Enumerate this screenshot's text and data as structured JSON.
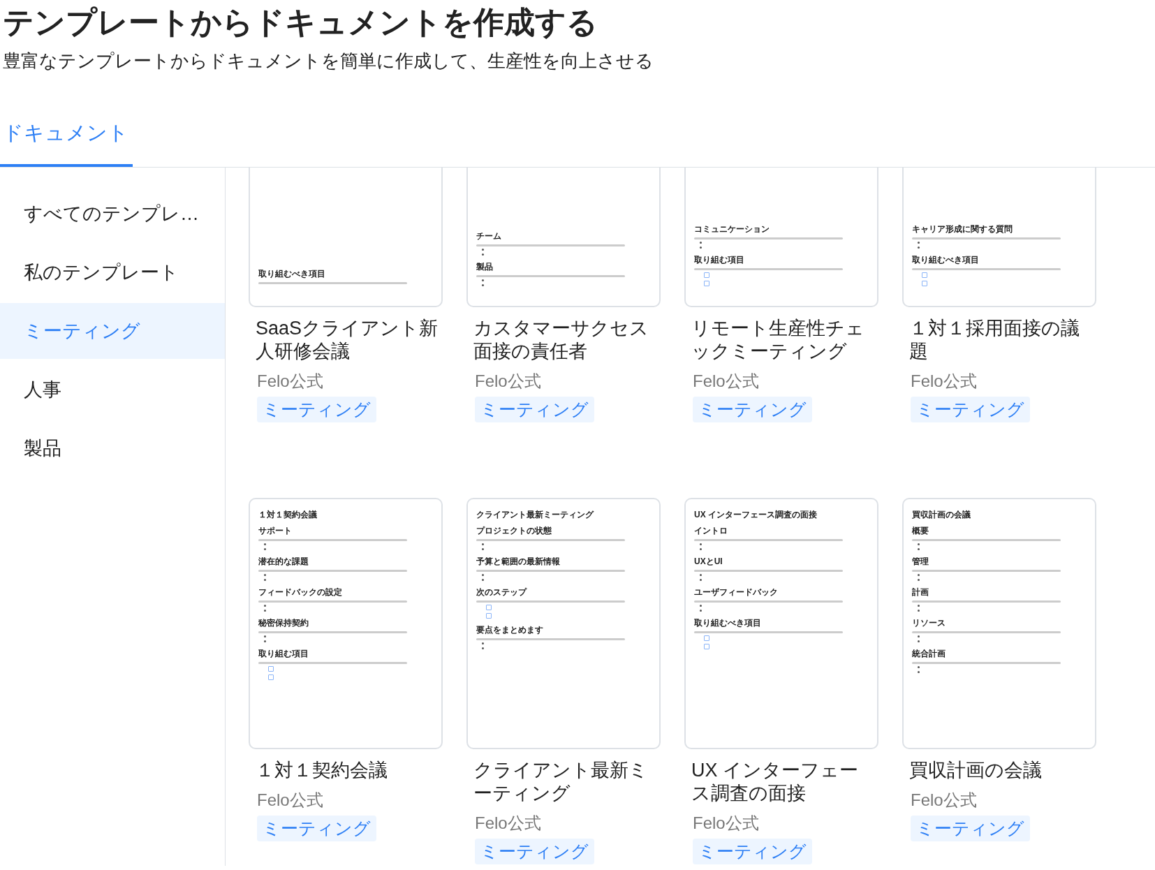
{
  "header": {
    "title": "テンプレートからドキュメントを作成する",
    "subtitle": "豊富なテンプレートからドキュメントを簡単に作成して、生産性を向上させる"
  },
  "tabs": [
    {
      "label": "ドキュメント",
      "selected": true
    }
  ],
  "sidebar": {
    "items": [
      {
        "label": "すべてのテンプレ…",
        "selected": false
      },
      {
        "label": "私のテンプレート",
        "selected": false
      },
      {
        "label": "ミーティング",
        "selected": true
      },
      {
        "label": "人事",
        "selected": false
      },
      {
        "label": "製品",
        "selected": false
      }
    ]
  },
  "templates": [
    {
      "title": "SaaSクライアント新人研修会議",
      "author": "Felo公式",
      "tag": "ミーティング",
      "preview": {
        "sections": [
          {
            "heading": "取り組むべき項目"
          }
        ]
      }
    },
    {
      "title": "カスタマーサクセス面接の責任者",
      "author": "Felo公式",
      "tag": "ミーティング",
      "preview": {
        "sections": [
          {
            "heading": "チーム",
            "kind": "bullets"
          },
          {
            "heading": "製品",
            "kind": "bullets"
          }
        ]
      }
    },
    {
      "title": "リモート生産性チェックミーティング",
      "author": "Felo公式",
      "tag": "ミーティング",
      "preview": {
        "sections": [
          {
            "heading": "コミュニケーション",
            "kind": "bullets"
          },
          {
            "heading": "取り組む項目",
            "kind": "checkboxes",
            "checkboxes": [
              {
                "checked": false
              },
              {
                "checked": false
              }
            ]
          }
        ]
      }
    },
    {
      "title": "１対１採用面接の議題",
      "author": "Felo公式",
      "tag": "ミーティング",
      "preview": {
        "sections": [
          {
            "heading": "キャリア形成に関する質問",
            "kind": "bullets"
          },
          {
            "heading": "取り組むべき項目",
            "kind": "checkboxes",
            "checkboxes": [
              {
                "checked": false
              },
              {
                "checked": false
              }
            ]
          }
        ]
      }
    },
    {
      "title": "１対１契約会議",
      "author": "Felo公式",
      "tag": "ミーティング",
      "preview": {
        "title": "１対１契約会議",
        "sections": [
          {
            "heading": "サポート",
            "kind": "bullets"
          },
          {
            "heading": "潜在的な課題",
            "kind": "bullets"
          },
          {
            "heading": "フィードバックの設定",
            "kind": "bullets"
          },
          {
            "heading": "秘密保持契約",
            "kind": "bullets"
          },
          {
            "heading": "取り組む項目",
            "kind": "checkboxes",
            "checkboxes": [
              {
                "checked": false
              },
              {
                "checked": false
              }
            ]
          }
        ]
      }
    },
    {
      "title": "クライアント最新ミーティング",
      "author": "Felo公式",
      "tag": "ミーティング",
      "preview": {
        "title": "クライアント最新ミーティング",
        "sections": [
          {
            "heading": "プロジェクトの状態",
            "kind": "bullets"
          },
          {
            "heading": "予算と範囲の最新情報",
            "kind": "bullets"
          },
          {
            "heading": "次のステップ",
            "kind": "checkboxes",
            "checkboxes": [
              {
                "checked": false
              },
              {
                "checked": false
              }
            ]
          },
          {
            "heading": "要点をまとめます",
            "kind": "bullets"
          }
        ]
      }
    },
    {
      "title": "UX インターフェース調査の面接",
      "author": "Felo公式",
      "tag": "ミーティング",
      "preview": {
        "title": "UX インターフェース調査の面接",
        "sections": [
          {
            "heading": "イントロ",
            "kind": "bullets"
          },
          {
            "heading": "UXとUI",
            "kind": "bullets"
          },
          {
            "heading": "ユーザフィードバック",
            "kind": "bullets"
          },
          {
            "heading": "取り組むべき項目",
            "kind": "checkboxes",
            "checkboxes": [
              {
                "checked": false
              },
              {
                "checked": false
              }
            ]
          }
        ]
      }
    },
    {
      "title": "買収計画の会議",
      "author": "Felo公式",
      "tag": "ミーティング",
      "preview": {
        "title": "買収計画の会議",
        "sections": [
          {
            "heading": "概要",
            "kind": "bullets"
          },
          {
            "heading": "管理",
            "kind": "bullets"
          },
          {
            "heading": "計画",
            "kind": "bullets"
          },
          {
            "heading": "リソース",
            "kind": "bullets"
          },
          {
            "heading": "統合計画",
            "kind": "bullets"
          }
        ]
      }
    }
  ]
}
